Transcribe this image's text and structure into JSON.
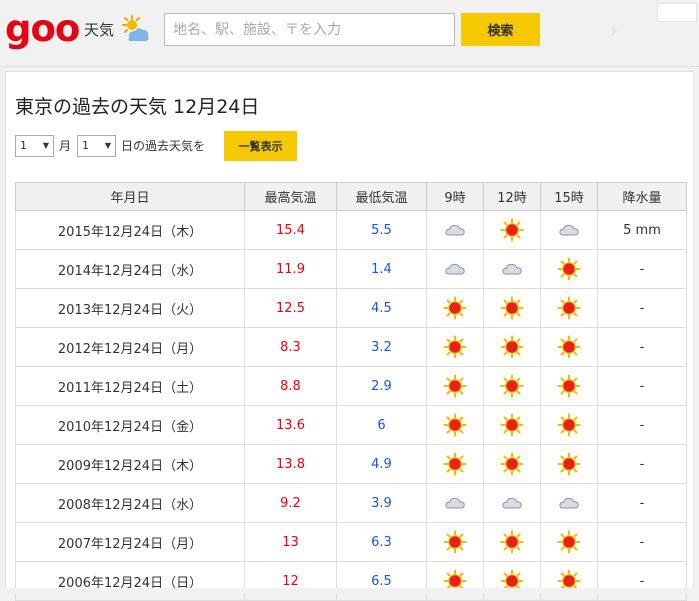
{
  "header": {
    "logo": "goo",
    "logo_sub": "天気",
    "logo_icon": "sun-cloud-icon",
    "search_placeholder": "地名、駅、施設、〒を入力",
    "search_button": "検索"
  },
  "page": {
    "title": "東京の過去の天気 12月24日"
  },
  "controls": {
    "month_value": "1",
    "month_label": "月",
    "day_value": "1",
    "day_label": "日の過去天気を",
    "list_button": "一覧表示"
  },
  "table": {
    "headers": [
      "年月日",
      "最高気温",
      "最低気温",
      "9時",
      "12時",
      "15時",
      "降水量"
    ],
    "rows": [
      {
        "date": "2015年12月24日（木）",
        "high": "15.4",
        "low": "5.5",
        "w9": "cloudy",
        "w12": "sunny",
        "w15": "cloudy",
        "rain": "5 mm"
      },
      {
        "date": "2014年12月24日（水）",
        "high": "11.9",
        "low": "1.4",
        "w9": "cloudy",
        "w12": "cloudy",
        "w15": "sunny",
        "rain": "-"
      },
      {
        "date": "2013年12月24日（火）",
        "high": "12.5",
        "low": "4.5",
        "w9": "sunny",
        "w12": "sunny",
        "w15": "sunny",
        "rain": "-"
      },
      {
        "date": "2012年12月24日（月）",
        "high": "8.3",
        "low": "3.2",
        "w9": "sunny",
        "w12": "sunny",
        "w15": "sunny",
        "rain": "-"
      },
      {
        "date": "2011年12月24日（土）",
        "high": "8.8",
        "low": "2.9",
        "w9": "sunny",
        "w12": "sunny",
        "w15": "sunny",
        "rain": "-"
      },
      {
        "date": "2010年12月24日（金）",
        "high": "13.6",
        "low": "6",
        "w9": "sunny",
        "w12": "sunny",
        "w15": "sunny",
        "rain": "-"
      },
      {
        "date": "2009年12月24日（木）",
        "high": "13.8",
        "low": "4.9",
        "w9": "sunny",
        "w12": "sunny",
        "w15": "sunny",
        "rain": "-"
      },
      {
        "date": "2008年12月24日（水）",
        "high": "9.2",
        "low": "3.9",
        "w9": "cloudy",
        "w12": "cloudy",
        "w15": "cloudy",
        "rain": "-"
      },
      {
        "date": "2007年12月24日（月）",
        "high": "13",
        "low": "6.3",
        "w9": "sunny",
        "w12": "sunny",
        "w15": "sunny",
        "rain": "-"
      },
      {
        "date": "2006年12月24日（日）",
        "high": "12",
        "low": "6.5",
        "w9": "sunny",
        "w12": "sunny",
        "w15": "sunny",
        "rain": "-"
      }
    ]
  },
  "colors": {
    "brand": "#e60012",
    "accent": "#f5c800",
    "high_temp": "#e60012",
    "low_temp": "#1a55d8"
  }
}
